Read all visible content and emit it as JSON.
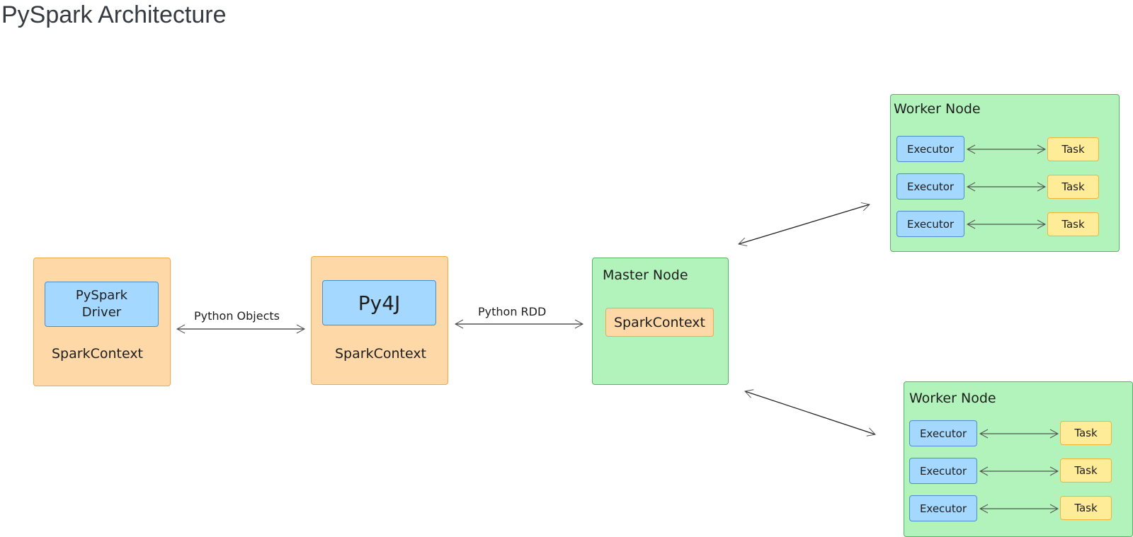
{
  "title": "PySpark Architecture",
  "driver": {
    "inner_label": "PySpark\nDriver",
    "label": "SparkContext"
  },
  "py4j": {
    "inner_label": "Py4J",
    "label": "SparkContext"
  },
  "master": {
    "title": "Master Node",
    "inner_label": "SparkContext"
  },
  "edges": {
    "driver_py4j": "Python Objects",
    "py4j_master": "Python RDD"
  },
  "workers": [
    {
      "title": "Worker Node",
      "rows": [
        {
          "executor": "Executor",
          "task": "Task"
        },
        {
          "executor": "Executor",
          "task": "Task"
        },
        {
          "executor": "Executor",
          "task": "Task"
        }
      ]
    },
    {
      "title": "Worker Node",
      "rows": [
        {
          "executor": "Executor",
          "task": "Task"
        },
        {
          "executor": "Executor",
          "task": "Task"
        },
        {
          "executor": "Executor",
          "task": "Task"
        }
      ]
    }
  ],
  "colors": {
    "orange": "#ffd8a8",
    "green": "#b2f2bb",
    "blue": "#a5d8ff",
    "yellow": "#ffec99"
  }
}
